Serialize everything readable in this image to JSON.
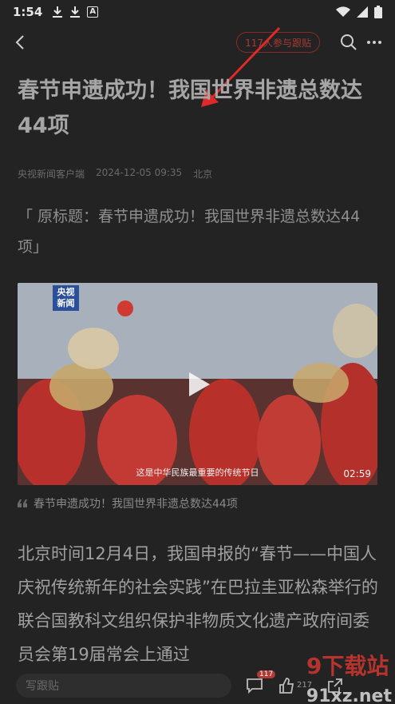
{
  "status_bar": {
    "time": "1:54",
    "notification_icons": [
      "download-icon",
      "download-icon",
      "app-icon"
    ],
    "app_icon_letter": "A"
  },
  "topbar": {
    "discuss_label": "117人参与跟贴"
  },
  "article": {
    "title": "春节申遗成功！我国世界非遗总数达44项",
    "source": "央视新闻客户端",
    "datetime": "2024-12-05 09:35",
    "location": "北京",
    "original_title": "「 原标题：春节申遗成功！我国世界非遗总数达44项」",
    "video": {
      "logo_top": "央视",
      "logo_bottom": "新闻",
      "subtitle": "这是中华民族最重要的传统节日",
      "duration": "02:59"
    },
    "video_caption": "春节申遗成功！我国世界非遗总数达44项",
    "body": "北京时间12月4日，我国申报的“春节——中国人庆祝传统新年的社会实践”在巴拉圭亚松森举行的联合国教科文组织保护非物质文化遗产政府间委员会第19届常会上通过"
  },
  "bottom_bar": {
    "write_placeholder": "写跟贴",
    "comment_count": "117",
    "like_count": "217"
  },
  "watermark": {
    "text": "9下载站",
    "domain": "91xz.net"
  },
  "colors": {
    "background": "#232323",
    "accent": "#b33a34",
    "arrow": "#e02a2a"
  }
}
